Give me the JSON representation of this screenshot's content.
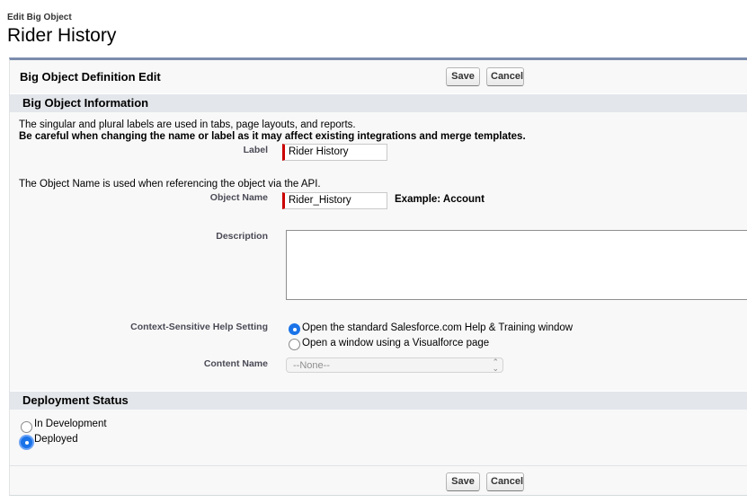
{
  "header": {
    "subtitle": "Edit Big Object",
    "title": "Rider History"
  },
  "panel": {
    "title": "Big Object Definition Edit",
    "save_label": "Save",
    "cancel_label": "Cancel"
  },
  "info_section": {
    "title": "Big Object Information",
    "intro_line1": "The singular and plural labels are used in tabs, page layouts, and reports.",
    "intro_line2": "Be careful when changing the name or label as it may affect existing integrations and merge templates.",
    "label_field": {
      "label": "Label",
      "value": "Rider History"
    },
    "api_note": "The Object Name is used when referencing the object via the API.",
    "object_name_field": {
      "label": "Object Name",
      "value": "Rider_History",
      "example": "Example:  Account"
    },
    "description_field": {
      "label": "Description",
      "value": ""
    },
    "help_setting": {
      "label": "Context-Sensitive Help Setting",
      "options": [
        {
          "label": "Open the standard Salesforce.com Help & Training window",
          "checked": true
        },
        {
          "label": "Open a window using a Visualforce page",
          "checked": false
        }
      ]
    },
    "content_name": {
      "label": "Content Name",
      "selected": "--None--"
    }
  },
  "deployment_section": {
    "title": "Deployment Status",
    "options": [
      {
        "label": "In Development",
        "checked": false
      },
      {
        "label": "Deployed",
        "checked": true
      }
    ]
  },
  "footer": {
    "save_label": "Save",
    "cancel_label": "Cancel"
  },
  "colors": {
    "panel_border": "#7b8cad",
    "section_bar": "#e3e6ea",
    "required_marker": "#cc0000",
    "radio_checked": "#1b73e8"
  }
}
